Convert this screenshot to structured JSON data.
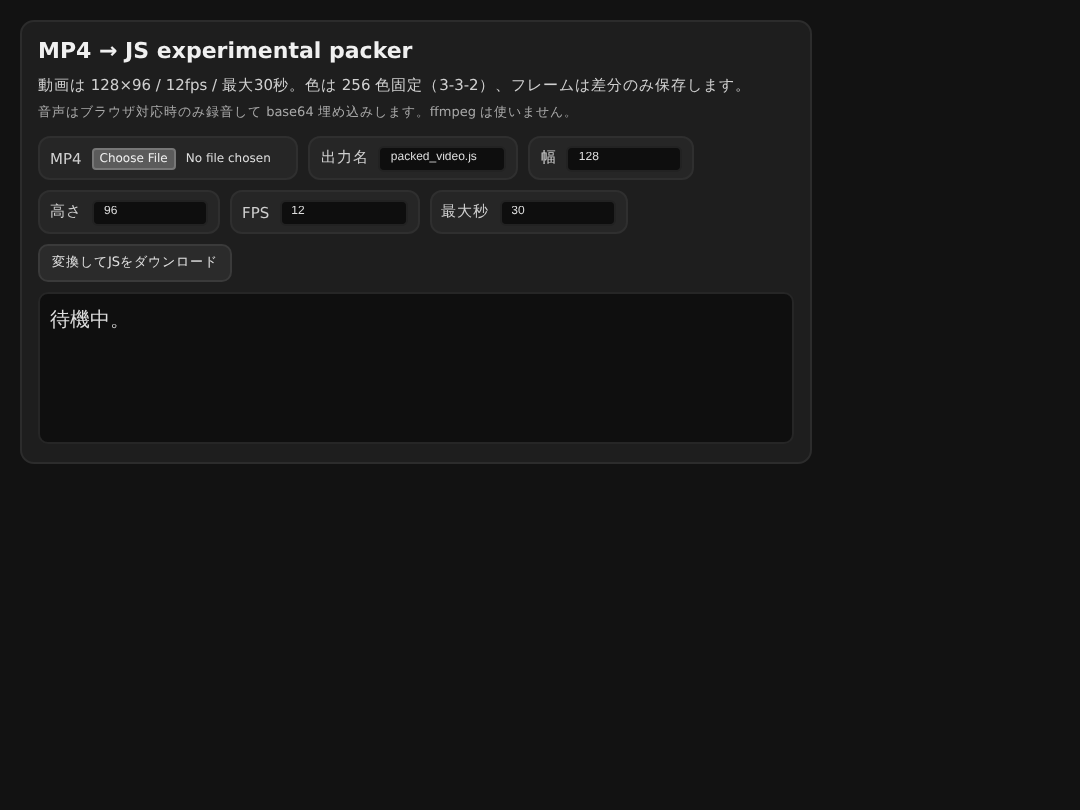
{
  "title": "MP4 → JS experimental packer",
  "description": "動画は 128×96 / 12fps / 最大30秒。色は 256 色固定（3-3-2）、フレームは差分のみ保存します。",
  "note": "音声はブラウザ対応時のみ録音して base64 埋め込みします。ffmpeg は使いません。",
  "fields": [
    {
      "kind": "file",
      "label": "MP4",
      "button": "Choose File",
      "status": "No file chosen"
    },
    {
      "kind": "text",
      "label": "出力名",
      "value": "packed_video.js"
    },
    {
      "kind": "text",
      "label": "幅",
      "value": "128"
    },
    {
      "kind": "text",
      "label": "高さ",
      "value": "96"
    },
    {
      "kind": "text",
      "label": "FPS",
      "value": "12"
    },
    {
      "kind": "text",
      "label": "最大秒",
      "value": "30"
    }
  ],
  "convert_button": "変換してJSをダウンロード",
  "log": "待機中。"
}
